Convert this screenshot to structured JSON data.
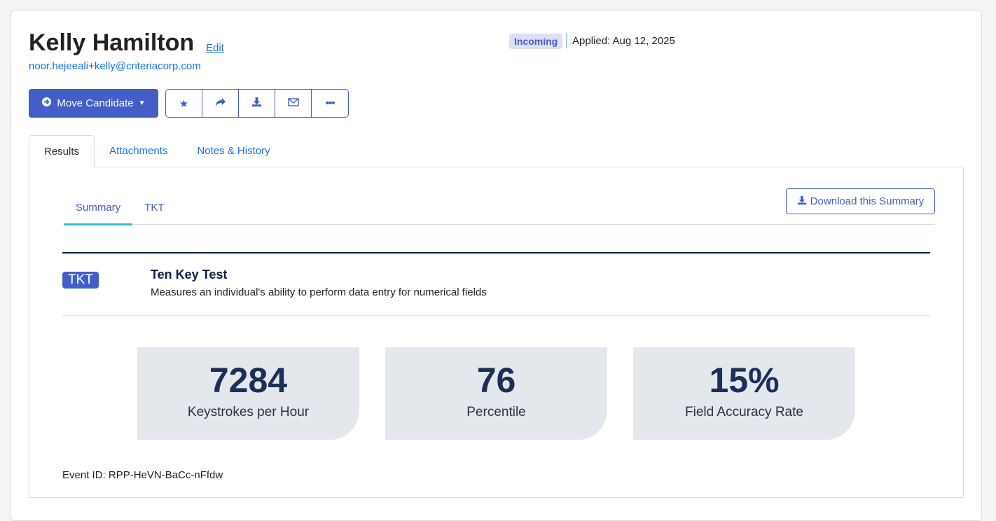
{
  "candidate": {
    "name": "Kelly Hamilton",
    "edit": "Edit",
    "email": "noor.hejeeali+kelly@criteriacorp.com",
    "status": "Incoming",
    "applied": "Applied: Aug 12, 2025"
  },
  "actions": {
    "move": "Move Candidate",
    "icons": [
      "star-icon",
      "share-icon",
      "download-icon",
      "envelope-icon",
      "more-icon"
    ]
  },
  "tabs": [
    "Results",
    "Attachments",
    "Notes & History"
  ],
  "subtabs": [
    "Summary",
    "TKT"
  ],
  "download": "Download this Summary",
  "test": {
    "badge": "TKT",
    "title": "Ten Key Test",
    "description": "Measures an individual's ability to perform data entry for numerical fields"
  },
  "metrics": [
    {
      "value": "7284",
      "label": "Keystrokes per Hour"
    },
    {
      "value": "76",
      "label": "Percentile"
    },
    {
      "value": "15%",
      "label": "Field Accuracy Rate"
    }
  ],
  "event_id": "Event ID: RPP-HeVN-BaCc-nFfdw",
  "colors": {
    "primary": "#435ec6",
    "link": "#1a73e8",
    "navy": "#0f1f45",
    "accent": "#2ec4c8"
  }
}
